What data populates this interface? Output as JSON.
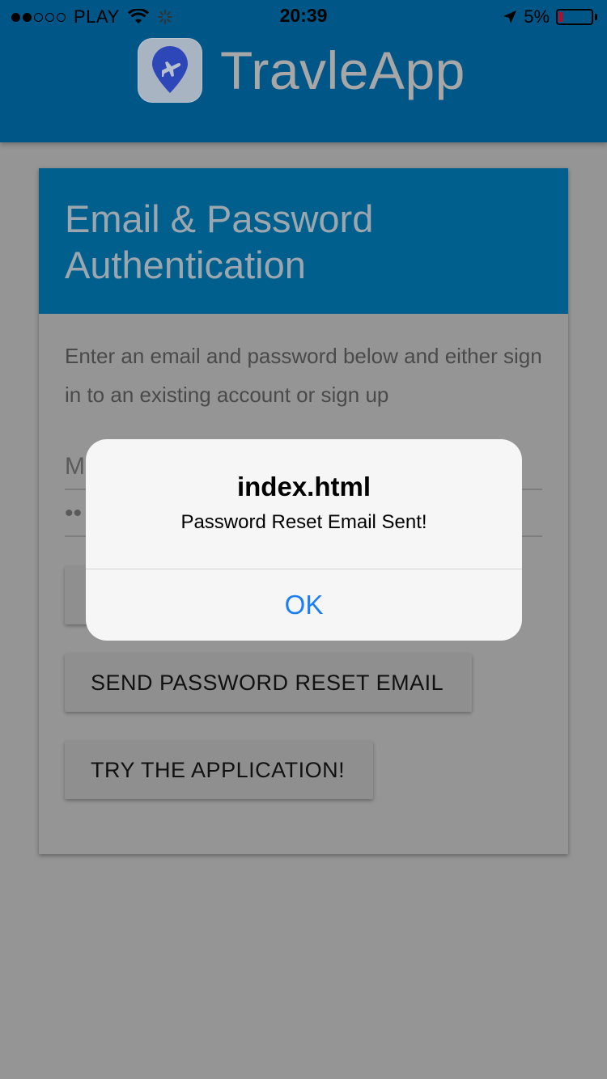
{
  "status_bar": {
    "carrier": "PLAY",
    "time": "20:39",
    "battery": "5%",
    "signal_filled": 2,
    "signal_total": 5
  },
  "header": {
    "app_name": "TravleApp"
  },
  "card": {
    "title_line1": "Email & Password",
    "title_line2": "Authentication",
    "description": "Enter an email and password below and either sign in to an existing account or sign up",
    "email_value": "M",
    "password_value": "••",
    "reset_button": "SEND PASSWORD RESET EMAIL",
    "try_button": "TRY THE APPLICATION!"
  },
  "alert": {
    "title": "index.html",
    "message": "Password Reset Email Sent!",
    "ok_label": "OK"
  },
  "colors": {
    "header_bg": "#005687",
    "card_header_bg": "#005f8c",
    "overlay_bg": "#959595",
    "alert_bg": "#f6f6f6",
    "ok_color": "#1a7ef7"
  }
}
